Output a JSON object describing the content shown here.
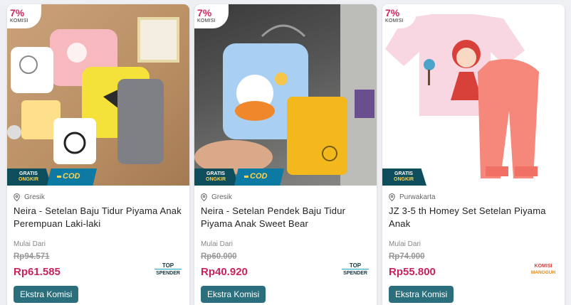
{
  "products": [
    {
      "commission_pct": "7%",
      "commission_label": "KOMISI",
      "shipping_badge": {
        "line1": "GRATIS",
        "line2": "ONGKIR"
      },
      "cod_label": "COD",
      "location": "Gresik",
      "title": "Neira - Setelan Baju Tidur Piyama Anak Perempuan Laki-laki",
      "price_label": "Mulai Dari",
      "original_price": "Rp94.571",
      "price": "Rp61.585",
      "seller_badge": {
        "line1": "TOP",
        "line2": "SPENDER"
      },
      "action_label": "Ekstra Komisi"
    },
    {
      "commission_pct": "7%",
      "commission_label": "KOMISI",
      "shipping_badge": {
        "line1": "GRATIS",
        "line2": "ONGKIR"
      },
      "cod_label": "COD",
      "location": "Gresik",
      "title": "Neira - Setelan Pendek Baju Tidur Piyama Anak Sweet Bear",
      "price_label": "Mulai Dari",
      "original_price": "Rp60.000",
      "price": "Rp40.920",
      "seller_badge": {
        "line1": "TOP",
        "line2": "SPENDER"
      },
      "action_label": "Ekstra Komisi"
    },
    {
      "commission_pct": "7%",
      "commission_label": "KOMISI",
      "shipping_badge": {
        "line1": "GRATIS",
        "line2": "ONGKIR"
      },
      "location": "Purwakarta",
      "title": "JZ 3-5 th Homey Set Setelan Piyama Anak",
      "price_label": "Mulai Dari",
      "original_price": "Rp74.000",
      "price": "Rp55.800",
      "seller_badge": {
        "line1": "KOMISI",
        "line2": "MANGGUH"
      },
      "action_label": "Ekstra Komisi"
    }
  ],
  "colors": {
    "commission": "#d2275f",
    "price": "#c8235e",
    "action_button": "#2b6f7d",
    "shipping_badge": "#0d4d5c",
    "cod_badge": "#0c7aa3"
  }
}
